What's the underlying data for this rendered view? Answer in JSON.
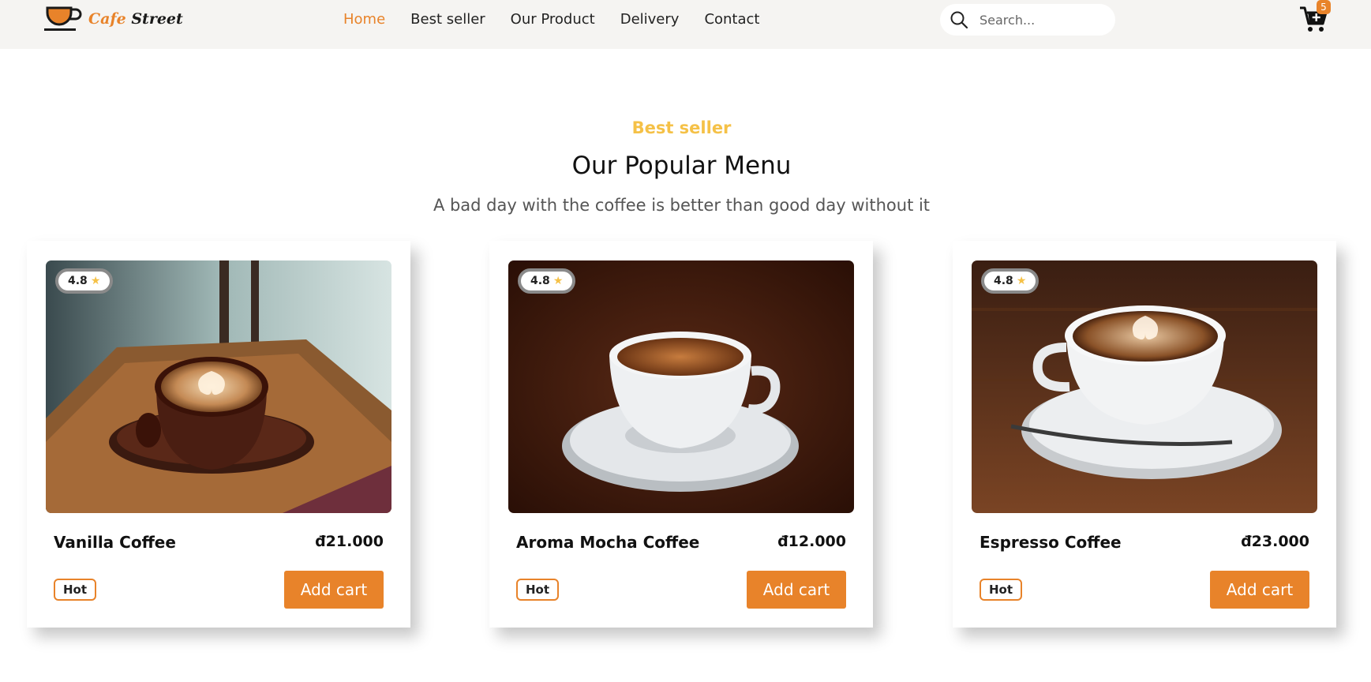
{
  "header": {
    "logo": {
      "word1": "Cafe",
      "word2": "Street"
    },
    "nav": [
      {
        "label": "Home",
        "active": true
      },
      {
        "label": "Best seller",
        "active": false
      },
      {
        "label": "Our Product",
        "active": false
      },
      {
        "label": "Delivery",
        "active": false
      },
      {
        "label": "Contact",
        "active": false
      }
    ],
    "search": {
      "placeholder": "Search...",
      "value": ""
    },
    "cart": {
      "count": "5"
    }
  },
  "section": {
    "eyebrow": "Best seller",
    "title": "Our Popular Menu",
    "subtitle": "A bad day with the coffee is better than good day without it"
  },
  "products": [
    {
      "name": "Vanilla Coffee",
      "price": "đ21.000",
      "rating": "4.8",
      "tag": "Hot",
      "button": "Add cart"
    },
    {
      "name": "Aroma Mocha Coffee",
      "price": "đ12.000",
      "rating": "4.8",
      "tag": "Hot",
      "button": "Add cart"
    },
    {
      "name": "Espresso Coffee",
      "price": "đ23.000",
      "rating": "4.8",
      "tag": "Hot",
      "button": "Add cart"
    }
  ],
  "colors": {
    "accent": "#e8832a",
    "eyebrow": "#f5c147",
    "header_bg": "#f5f4f2"
  },
  "icons": {
    "search": "search-icon",
    "cart": "cart-plus-icon",
    "star": "star-icon"
  }
}
